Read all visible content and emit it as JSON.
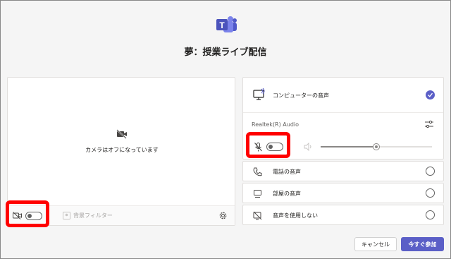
{
  "meeting": {
    "title": "夢：授業ライブ配信"
  },
  "camera": {
    "off_message": "カメラはオフになっています",
    "background_filter_label": "背景フィルター",
    "enabled": false
  },
  "audio": {
    "computer_audio": {
      "label": "コンピューターの音声",
      "selected": true
    },
    "device_name": "Realtek(R) Audio",
    "mic_enabled": false,
    "volume_level": 0.5,
    "options": [
      {
        "label": "電話の音声",
        "icon": "phone-icon",
        "selected": false
      },
      {
        "label": "部屋の音声",
        "icon": "room-device-icon",
        "selected": false
      },
      {
        "label": "音声を使用しない",
        "icon": "no-audio-icon",
        "selected": false
      }
    ]
  },
  "buttons": {
    "cancel": "キャンセル",
    "join_now": "今すぐ参加"
  },
  "colors": {
    "accent": "#5b5fc7",
    "highlight": "#ff0000"
  }
}
